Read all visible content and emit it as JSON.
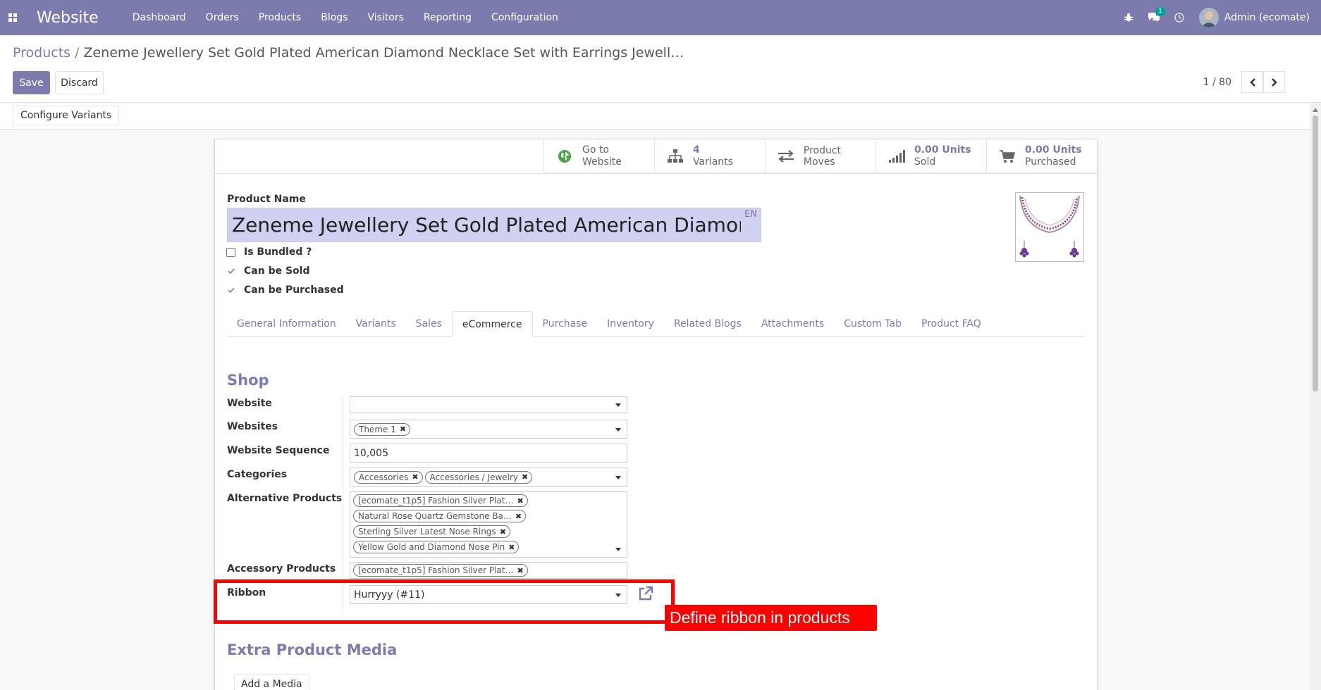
{
  "topbar": {
    "brand": "Website",
    "menu": [
      "Dashboard",
      "Orders",
      "Products",
      "Blogs",
      "Visitors",
      "Reporting",
      "Configuration"
    ],
    "chat_badge": "1",
    "user": "Admin (ecomate)"
  },
  "breadcrumb": {
    "parent": "Products",
    "separator": "/",
    "current": "Zeneme Jewellery Set Gold Plated American Diamond Necklace Set with Earrings Jewell…"
  },
  "actions": {
    "save": "Save",
    "discard": "Discard"
  },
  "pager": {
    "value": "1 / 80"
  },
  "statusbar": {
    "configure_variants": "Configure Variants"
  },
  "smart_buttons": [
    {
      "icon": "globe-icon",
      "value": "Go to",
      "label": "Website",
      "style": "plain"
    },
    {
      "icon": "sitemap-icon",
      "value": "4",
      "label": "Variants",
      "style": "stat"
    },
    {
      "icon": "exchange-icon",
      "value": "",
      "label": "Product Moves",
      "style": "single"
    },
    {
      "icon": "signal-icon",
      "value": "0.00 Units",
      "label": "Sold",
      "style": "stat"
    },
    {
      "icon": "cart-icon",
      "value": "0.00 Units",
      "label": "Purchased",
      "style": "stat"
    }
  ],
  "product": {
    "name_label": "Product Name",
    "name": "Zeneme Jewellery Set Gold Plated American Diamond Necklace Set with Earrings Jewellery",
    "lang": "EN",
    "is_bundled_label": "Is Bundled ?",
    "can_be_sold_label": "Can be Sold",
    "can_be_purchased_label": "Can be Purchased",
    "is_bundled": false,
    "can_be_sold": true,
    "can_be_purchased": true
  },
  "tabs": [
    "General Information",
    "Variants",
    "Sales",
    "eCommerce",
    "Purchase",
    "Inventory",
    "Related Blogs",
    "Attachments",
    "Custom Tab",
    "Product FAQ"
  ],
  "active_tab": "eCommerce",
  "shop": {
    "title": "Shop",
    "website_label": "Website",
    "website_value": "",
    "websites_label": "Websites",
    "websites_tags": [
      "Theme 1"
    ],
    "sequence_label": "Website Sequence",
    "sequence_value": "10,005",
    "categories_label": "Categories",
    "categories_tags": [
      "Accessories",
      "Accessories / Jewelry"
    ],
    "alternative_label": "Alternative Products",
    "alternative_tags": [
      "[ecomate_t1p5] Fashion Silver Plat…",
      "Natural Rose Quartz Gemstone Ba…",
      "Sterling Silver Latest Nose Rings",
      "Yellow Gold and Diamond Nose Pin"
    ],
    "accessory_label": "Accessory Products",
    "accessory_tags": [
      "[ecomate_t1p5] Fashion Silver Plat…"
    ],
    "ribbon_label": "Ribbon",
    "ribbon_value": "Hurryyy (#11)"
  },
  "extra_media": {
    "title": "Extra Product Media",
    "add_button": "Add a Media"
  },
  "annotation": {
    "text": "Define ribbon in products",
    "color": "#ff0000"
  },
  "colors": {
    "brand": "#7c7bad",
    "highlight": "#ff0000",
    "name_field": "#d0d0f0"
  }
}
